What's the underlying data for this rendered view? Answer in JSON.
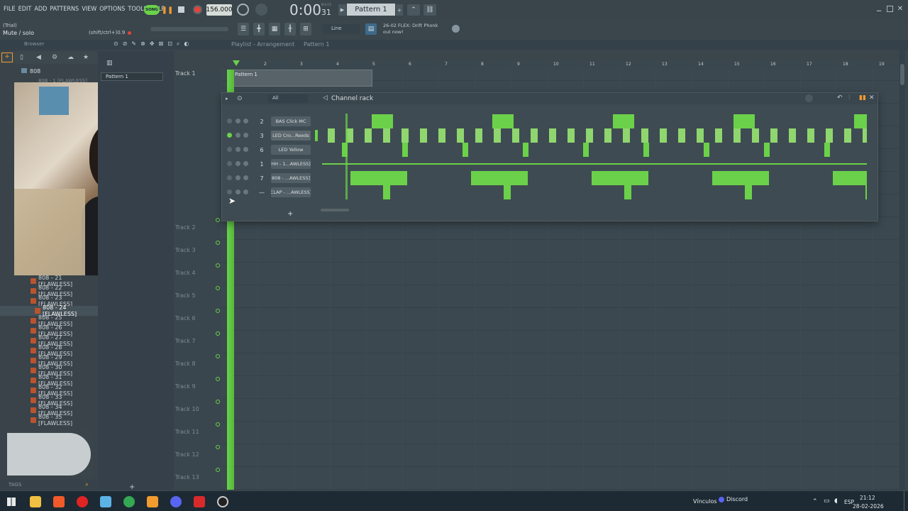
{
  "menu": [
    "FILE",
    "EDIT",
    "ADD",
    "PATTERNS",
    "VIEW",
    "OPTIONS",
    "TOOLS",
    "HELP"
  ],
  "song_mode": "SONG",
  "tempo": "156.000",
  "time": {
    "main": "0:00",
    "sub": "31",
    "label": "M:S:CS"
  },
  "pattern_name": "Pattern 1",
  "trial_label": "(Trial)",
  "hint_text": "Mute / solo",
  "shortcut_text": "(shift/ctrl+)0.9",
  "snap_label": "Line",
  "news": {
    "line1": "26-02 FLEX: Drift Phonk",
    "line2": "out now!"
  },
  "browser": {
    "title": "Browser",
    "folder": "808",
    "partial_item": "808 - 1 [FLAWLESS]",
    "items": [
      "808 - 21 [FLAWLESS]",
      "808 - 22 [FLAWLESS]",
      "808 - 23 [FLAWLESS]",
      "808 - 24 [FLAWLESS]",
      "808 - 25 [FLAWLESS]",
      "808 - 26 [FLAWLESS]",
      "808 - 27 [FLAWLESS]",
      "808 - 28 [FLAWLESS]",
      "808 - 29 [FLAWLESS]",
      "808 - 30 [FLAWLESS]",
      "808 - 31 [FLAWLESS]",
      "808 - 32 [FLAWLESS]",
      "808 - 33 [FLAWLESS]",
      "808 - 34 [FLAWLESS]",
      "808 - 35 [FLAWLESS]"
    ],
    "selected_index": 3,
    "tags_label": "TAGS"
  },
  "playlist": {
    "breadcrumb": "Playlist - Arrangement",
    "pattern_crumb": "Pattern 1",
    "pattern_clip_label": "Pattern 1",
    "pattern_list_item": "Pattern 1",
    "ruler": [
      "2",
      "3",
      "4",
      "5",
      "6",
      "7",
      "8",
      "9",
      "10",
      "11",
      "12",
      "13",
      "14",
      "15",
      "16",
      "17",
      "18",
      "19"
    ],
    "tracks": [
      "Track 1",
      "Track 2",
      "Track 3",
      "Track 4",
      "Track 5",
      "Track 6",
      "Track 7",
      "Track 8",
      "Track 9",
      "Track 10",
      "Track 11",
      "Track 12",
      "Track 13"
    ]
  },
  "channel_rack": {
    "title": "Channel rack",
    "filter": "All",
    "channels": [
      {
        "num": "2",
        "name": "BAS Click MC"
      },
      {
        "num": "3",
        "name": "LED Cro...Reeds"
      },
      {
        "num": "6",
        "name": "LED Yellow"
      },
      {
        "num": "1",
        "name": "HH - 1...AWLESS]"
      },
      {
        "num": "7",
        "name": "808 - ...AWLESS]"
      },
      {
        "num": "—",
        "name": "CLAP - ...AWLESS]"
      }
    ],
    "add_label": "+"
  },
  "taskbar": {
    "vinculos": "Vínculos",
    "discord": "Discord",
    "lang": "ESP",
    "clock": "21:12",
    "date": "28-02-2026"
  },
  "colors": {
    "accent_green": "#6bd14a",
    "orange": "#f29b2e",
    "bg": "#3a454c"
  }
}
